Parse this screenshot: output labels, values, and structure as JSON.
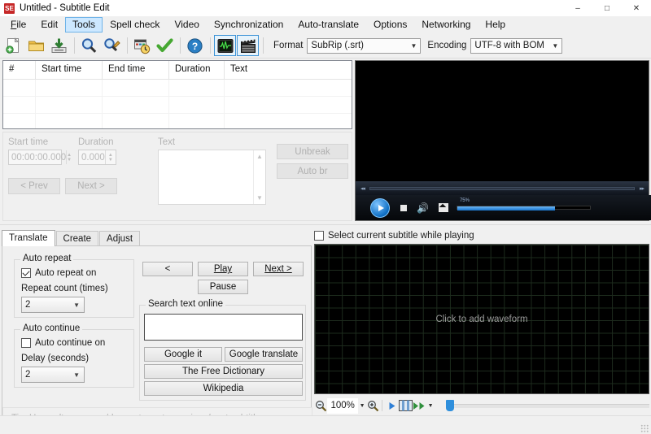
{
  "window": {
    "title": "Untitled - Subtitle Edit",
    "app_icon": "SE",
    "minimize_label": "–",
    "maximize_label": "□",
    "close_label": "✕"
  },
  "menubar": {
    "items": [
      {
        "label": "File",
        "accel": "F",
        "active": false
      },
      {
        "label": "Edit",
        "accel": "E",
        "active": false
      },
      {
        "label": "Tools",
        "accel": "T",
        "active": true
      },
      {
        "label": "Spell check",
        "accel": "S",
        "active": false
      },
      {
        "label": "Video",
        "accel": "V",
        "active": false
      },
      {
        "label": "Synchronization",
        "accel": "y",
        "active": false
      },
      {
        "label": "Auto-translate",
        "accel": "A",
        "active": false
      },
      {
        "label": "Options",
        "accel": "O",
        "active": false
      },
      {
        "label": "Networking",
        "accel": "N",
        "active": false
      },
      {
        "label": "Help",
        "accel": "H",
        "active": false
      }
    ]
  },
  "toolbar": {
    "buttons": [
      {
        "name": "new-file-icon",
        "title": "New"
      },
      {
        "name": "open-folder-icon",
        "title": "Open"
      },
      {
        "name": "save-icon",
        "title": "Save"
      },
      {
        "name": "find-icon",
        "title": "Find"
      },
      {
        "name": "replace-icon",
        "title": "Replace"
      },
      {
        "name": "fix-common-errors-icon",
        "title": "Fix common errors"
      },
      {
        "name": "spell-check-icon",
        "title": "Spell check"
      },
      {
        "name": "help-icon",
        "title": "Help"
      },
      {
        "name": "toggle-waveform-icon",
        "title": "Toggle waveform"
      },
      {
        "name": "toggle-video-icon",
        "title": "Toggle video"
      }
    ],
    "format_label": "Format",
    "format_value": "SubRip (.srt)",
    "encoding_label": "Encoding",
    "encoding_value": "UTF-8 with BOM"
  },
  "listview": {
    "columns": [
      {
        "label": "#",
        "width": 40
      },
      {
        "label": "Start time",
        "width": 82
      },
      {
        "label": "End time",
        "width": 82
      },
      {
        "label": "Duration",
        "width": 68
      },
      {
        "label": "Text",
        "width": 156
      }
    ],
    "rows": []
  },
  "editpanel": {
    "start_time_label": "Start time",
    "start_time_value": "00:00:00.000",
    "duration_label": "Duration",
    "duration_value": "0.000",
    "text_label": "Text",
    "text_value": "",
    "prev_label": "< Prev",
    "next_label": "Next >",
    "unbreak_label": "Unbreak",
    "autobr_label": "Auto br",
    "autobr_accel": "b"
  },
  "video": {
    "volume_percent": "75%",
    "seek_back_icon": "◂◂",
    "seek_fwd_icon": "▸▸"
  },
  "tabs": {
    "items": [
      {
        "label": "Translate",
        "active": true
      },
      {
        "label": "Create",
        "active": false
      },
      {
        "label": "Adjust",
        "active": false
      }
    ]
  },
  "translate": {
    "auto_repeat": {
      "group_label": "Auto repeat",
      "checkbox_label": "Auto repeat on",
      "checked": true,
      "count_label": "Repeat count (times)",
      "count_value": "2"
    },
    "auto_continue": {
      "group_label": "Auto continue",
      "checkbox_label": "Auto continue on",
      "checked": false,
      "delay_label": "Delay (seconds)",
      "delay_value": "2"
    },
    "playback": {
      "prev_label": "<",
      "play_label": "Play",
      "play_accel": "P",
      "next_label": "Next >",
      "next_accel": "N",
      "pause_label": "Pause"
    },
    "search": {
      "group_label": "Search text online",
      "input_value": "",
      "google_it_label": "Google it",
      "google_translate_label": "Google translate",
      "free_dictionary_label": "The Free Dictionary",
      "wikipedia_label": "Wikipedia"
    },
    "tip": "Tip: Use <alt+arrow up/down> to go to previous/next subtitle"
  },
  "waveform": {
    "select_while_playing_label": "Select current subtitle while playing",
    "select_while_playing_checked": false,
    "placeholder": "Click to add waveform",
    "zoom_out_icon": "zoom-out-icon",
    "zoom_value": "100%",
    "zoom_in_icon": "zoom-in-icon",
    "play_icon": "play-icon",
    "spectrogram_icon": "spectrogram-icon",
    "playback_speed_icon": "playback-speed-icon"
  },
  "colors": {
    "accent": "#2f8fdc",
    "menu_highlight": "#cde8ff",
    "window_bg": "#f0f0f0",
    "waveform_bg": "#000000",
    "waveform_grid": "#1d2b1d",
    "disabled_text": "#b4b4b4"
  }
}
